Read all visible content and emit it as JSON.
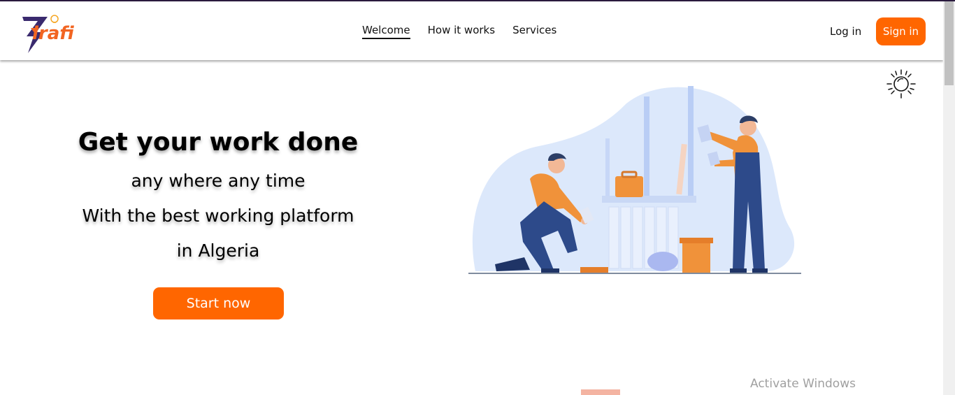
{
  "brand": {
    "logo_text": "irafi",
    "logo_initial": "Z",
    "accent": "#ff6600"
  },
  "nav": {
    "items": [
      {
        "label": "Welcome",
        "active": true
      },
      {
        "label": "How it works",
        "active": false
      },
      {
        "label": "Services",
        "active": false
      }
    ]
  },
  "auth": {
    "login_label": "Log in",
    "signin_label": "Sign in"
  },
  "theme_toggle": {
    "icon": "sun-icon"
  },
  "hero": {
    "heading": "Get your work done",
    "line1": "any where any time",
    "line2": "With the best working platform",
    "line3": "in Algeria",
    "cta_label": "Start now"
  },
  "illustration": {
    "icon": "workers-illustration"
  },
  "os_watermark": "Activate Windows"
}
